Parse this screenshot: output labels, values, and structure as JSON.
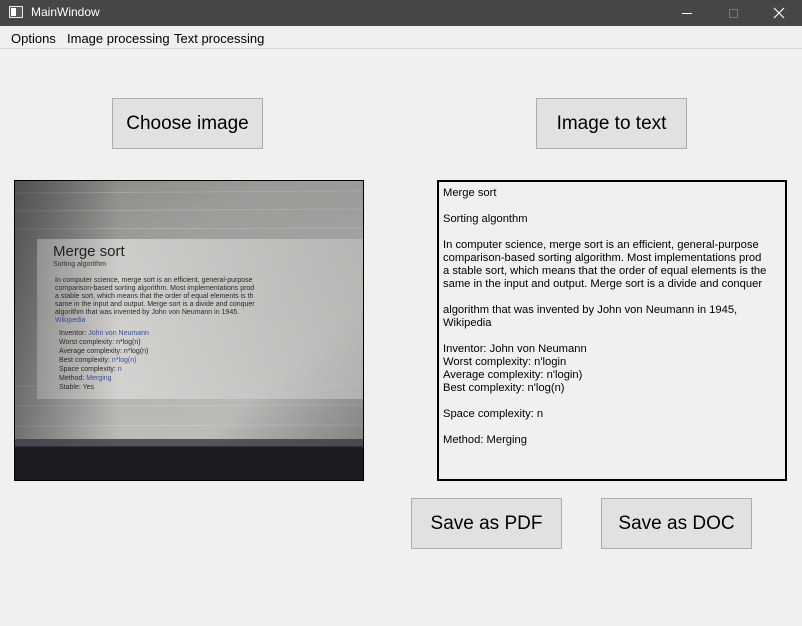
{
  "window": {
    "title": "MainWindow",
    "icons": {
      "app": "app-window-icon",
      "minimize": "minimize-icon",
      "maximize": "maximize-icon",
      "close": "close-icon"
    }
  },
  "menubar": {
    "items": [
      {
        "label": "Options"
      },
      {
        "label": "Image processing"
      },
      {
        "label": "Text processing"
      }
    ]
  },
  "buttons": {
    "choose_image": "Choose image",
    "image_to_text": "Image to text",
    "save_pdf": "Save as PDF",
    "save_doc": "Save as DOC"
  },
  "image_preview": {
    "heading": "Merge sort",
    "subheading": "Sorting algorithm",
    "body_lines": [
      "In computer science, merge sort is an efficient, general-purpose",
      "comparison-based sorting algorithm. Most implementations prod",
      "a stable sort, which means that the order of equal elements is th",
      "same in the input and output. Merge sort is a divide and conquer",
      "algorithm that was invented by John von Neumann in 1945."
    ],
    "link": "Wikipedia",
    "info_lines": [
      {
        "label": "Inventor: ",
        "value": "John von Neumann"
      },
      {
        "label": "Worst complexity: ",
        "value": "n*log(n)"
      },
      {
        "label": "Average complexity: ",
        "value": "n*log(n)"
      },
      {
        "label": "Best complexity: ",
        "value": "n*log(n)"
      },
      {
        "label": "Space complexity: ",
        "value": "n"
      },
      {
        "label": "Method: ",
        "value": "Merging"
      },
      {
        "label": "Stable: ",
        "value": "Yes"
      }
    ]
  },
  "ocr_text": "Merge sort\n\nSorting algonthm\n\nIn computer science, merge sort is an efficient, general-purpose\ncomparison-based sorting algorithm. Most implementations prod\na stable sort, which means that the order of equal elements is the\nsame in the input and output. Merge sort is a divide and conquer\n\nalgorithm that was invented by John von Neumann in 1945,\nWikipedia\n\nInventor: John von Neumann\nWorst complexity: n'login\nAverage complexity: n'login)\nBest complexity: n'log(n)\n\nSpace complexity: n\n\nMethod: Merging"
}
